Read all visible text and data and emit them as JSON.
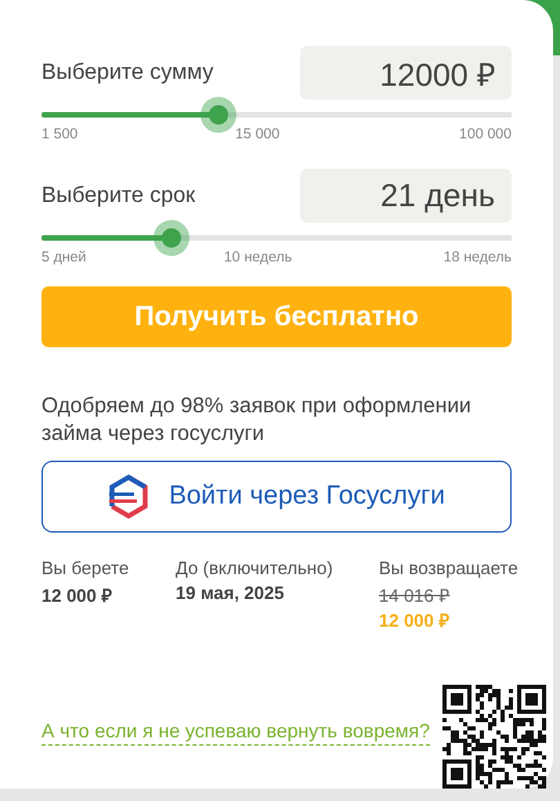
{
  "sliders": [
    {
      "label": "Выберите сумму",
      "value": "12000 ₽",
      "level": 0.377,
      "ticks": [
        "1 500",
        "15 000",
        "100 000"
      ]
    },
    {
      "label": "Выберите срок",
      "value": "21 день",
      "level": 0.275,
      "ticks": [
        "5 дней",
        "10 недель",
        "18 недель"
      ]
    }
  ],
  "primary_button": "Получить бесплатно",
  "note": "Одобряем до 98% заявок при оформлении займа через госуслуги",
  "gosuslugi_button": "Войти через Госуслуги",
  "summary": [
    {
      "label": "Вы берете",
      "value": "12 000 ₽"
    },
    {
      "label": "До (включительно)",
      "value": "19 мая, 2025"
    },
    {
      "label": "Вы возвращаете",
      "old_value": "14 016 ₽",
      "value": "12 000 ₽"
    }
  ],
  "help_link": "А что если я не успеваю вернуть вовремя?"
}
